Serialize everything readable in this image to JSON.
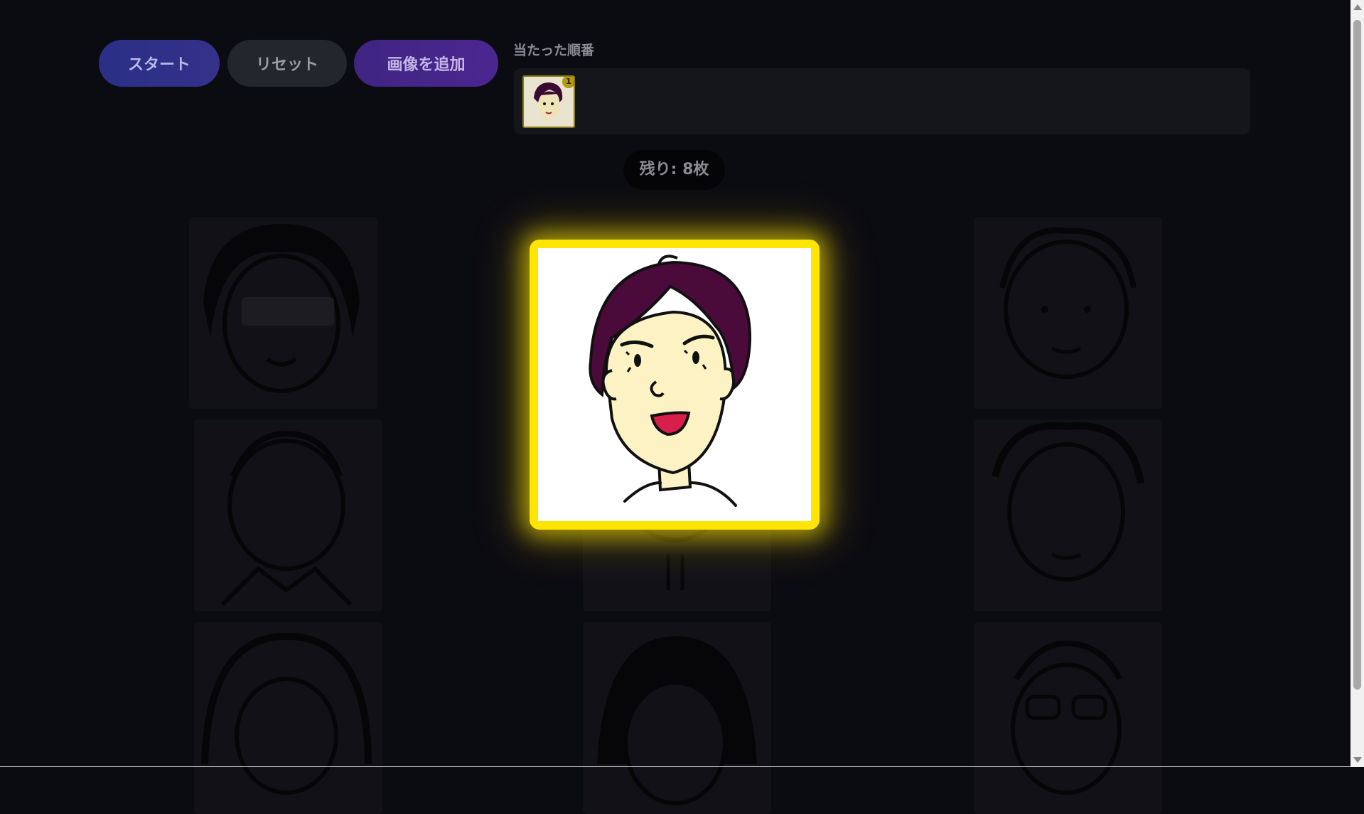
{
  "controls": {
    "start_label": "スタート",
    "reset_label": "リセット",
    "add_image_label": "画像を追加"
  },
  "order": {
    "label": "当たった順番",
    "items": [
      {
        "rank": "1",
        "avatar": "face-avatar-purple-hair"
      }
    ]
  },
  "remaining": {
    "text": "残り: 8枚"
  },
  "grid": {
    "cards": [
      {
        "avatar": "face-avatar-long-hair"
      },
      {
        "avatar": "face-avatar-short-hair"
      },
      {
        "avatar": "face-avatar-curly-hair"
      },
      {
        "avatar": "face-avatar-suit"
      },
      {
        "avatar": "face-avatar-spiky-hair"
      },
      {
        "avatar": "face-avatar-bob-hair"
      },
      {
        "avatar": "face-avatar-long-hair-2"
      },
      {
        "avatar": "face-avatar-glasses"
      }
    ]
  },
  "highlight": {
    "avatar": "face-avatar-purple-hair",
    "colors": {
      "border": "#ffe600",
      "hair": "#4a0a3a",
      "skin": "#fdf2c4",
      "lips": "#d81e4b"
    }
  }
}
